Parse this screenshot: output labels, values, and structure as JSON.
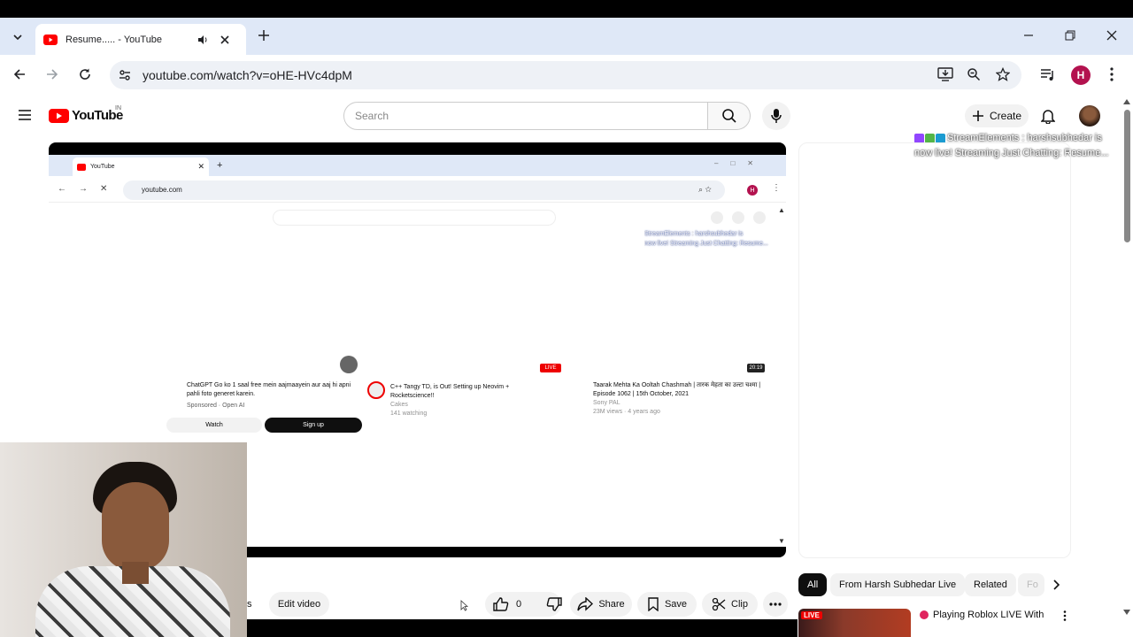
{
  "browser": {
    "tab_title": "Resume..... - YouTube",
    "url": "youtube.com/watch?v=oHE-HVc4dpM",
    "profile_initial": "H"
  },
  "youtube": {
    "logo_text": "YouTube",
    "region": "IN",
    "search_placeholder": "Search",
    "create_label": "Create"
  },
  "overlay": {
    "stream_text_line1": "StreamElements : harshsubhedar is",
    "stream_text_line2": "now live! Streaming Just Chatting: Resume..."
  },
  "video_inner": {
    "tab_title": "YouTube",
    "url": "youtube.com",
    "profile_initial": "H",
    "cards": [
      {
        "title": "ChatGPT Go ko 1 saal free mein aajmaayein aur aaj hi apni pahli foto generet karein.",
        "meta": "Sponsored · Open AI",
        "btn1": "Watch",
        "btn2": "Sign up"
      },
      {
        "title": "C++ Tangy TD, is Out! Setting up Neovim + Rocketscience!!",
        "meta1": "Cakes",
        "meta2": "141 watching",
        "badge": "LIVE"
      },
      {
        "title": "Taarak Mehta Ka Ooltah Chashmah | तारक मेहता का उल्टा चश्मा | Episode 1062 | 15th October, 2021",
        "meta1": "Sony PAL",
        "meta2": "23M views · 4 years ago",
        "duration": "20:19"
      }
    ]
  },
  "actions": {
    "edit_video": "Edit video",
    "partial_left": "s",
    "like_count": "0",
    "share": "Share",
    "save": "Save",
    "clip": "Clip"
  },
  "chips": {
    "all": "All",
    "from_channel": "From Harsh Subhedar Live",
    "related": "Related",
    "partial": "Fo"
  },
  "sidebar_video": {
    "live_badge": "LIVE",
    "title": "Playing Roblox LIVE With"
  },
  "colors": {
    "youtube_red": "#ff0000",
    "tab_strip": "#dfe8f7",
    "profile": "#b3124f",
    "chip_active": "#0f0f0f"
  }
}
